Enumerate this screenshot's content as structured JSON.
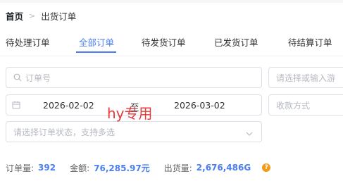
{
  "breadcrumb": {
    "home": "首页",
    "separator": ">",
    "current": "出货订单"
  },
  "tabs": [
    {
      "label": "待处理订单",
      "active": false
    },
    {
      "label": "全部订单",
      "active": true
    },
    {
      "label": "待发货订单",
      "active": false
    },
    {
      "label": "已发货订单",
      "active": false
    },
    {
      "label": "待结算订单",
      "active": false
    }
  ],
  "filters": {
    "order_no_placeholder": "订单号",
    "search_placeholder": "请选择或输入游",
    "date_start": "2026-02-02",
    "date_sep": "至",
    "date_end": "2026-03-02",
    "payment_placeholder": "收款方式",
    "status_placeholder": "请选择订单状态，支持多选"
  },
  "watermark": "hy专用",
  "summary": {
    "order_count_label": "订单量:",
    "order_count_value": "392",
    "amount_label": "金额:",
    "amount_value": "76,285.97元",
    "shipment_label": "出货量:",
    "shipment_value": "2,676,486G",
    "help_symbol": "?"
  },
  "colors": {
    "accent": "#4a7ef0",
    "watermark": "#e23c3c",
    "help": "#f29b1b",
    "border": "#dcdfe6"
  },
  "icons": [
    "search-icon",
    "calendar-icon",
    "chevron-down-icon",
    "help-icon"
  ]
}
